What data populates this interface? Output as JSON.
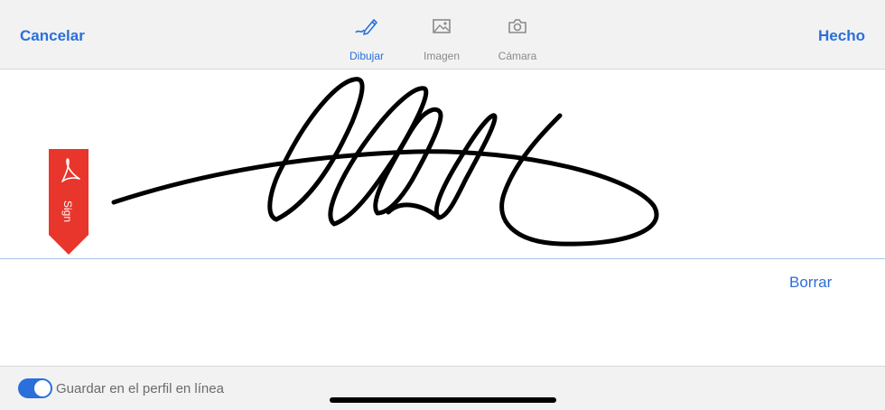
{
  "header": {
    "cancel_label": "Cancelar",
    "done_label": "Hecho",
    "tabs": [
      {
        "label": "Dibujar",
        "icon": "pen-draw-icon",
        "active": true
      },
      {
        "label": "Imagen",
        "icon": "image-icon",
        "active": false
      },
      {
        "label": "Cámara",
        "icon": "camera-icon",
        "active": false
      }
    ]
  },
  "canvas": {
    "badge_text": "Sign",
    "badge_icon": "adobe-acrobat-icon",
    "clear_label": "Borrar"
  },
  "footer": {
    "save_toggle_label": "Guardar en el perfil en línea",
    "save_toggle_on": true
  },
  "colors": {
    "accent": "#2a6fdb",
    "badge_red": "#e8362d",
    "bar_bg": "#f2f2f2",
    "inactive_text": "#8a8a8a"
  }
}
